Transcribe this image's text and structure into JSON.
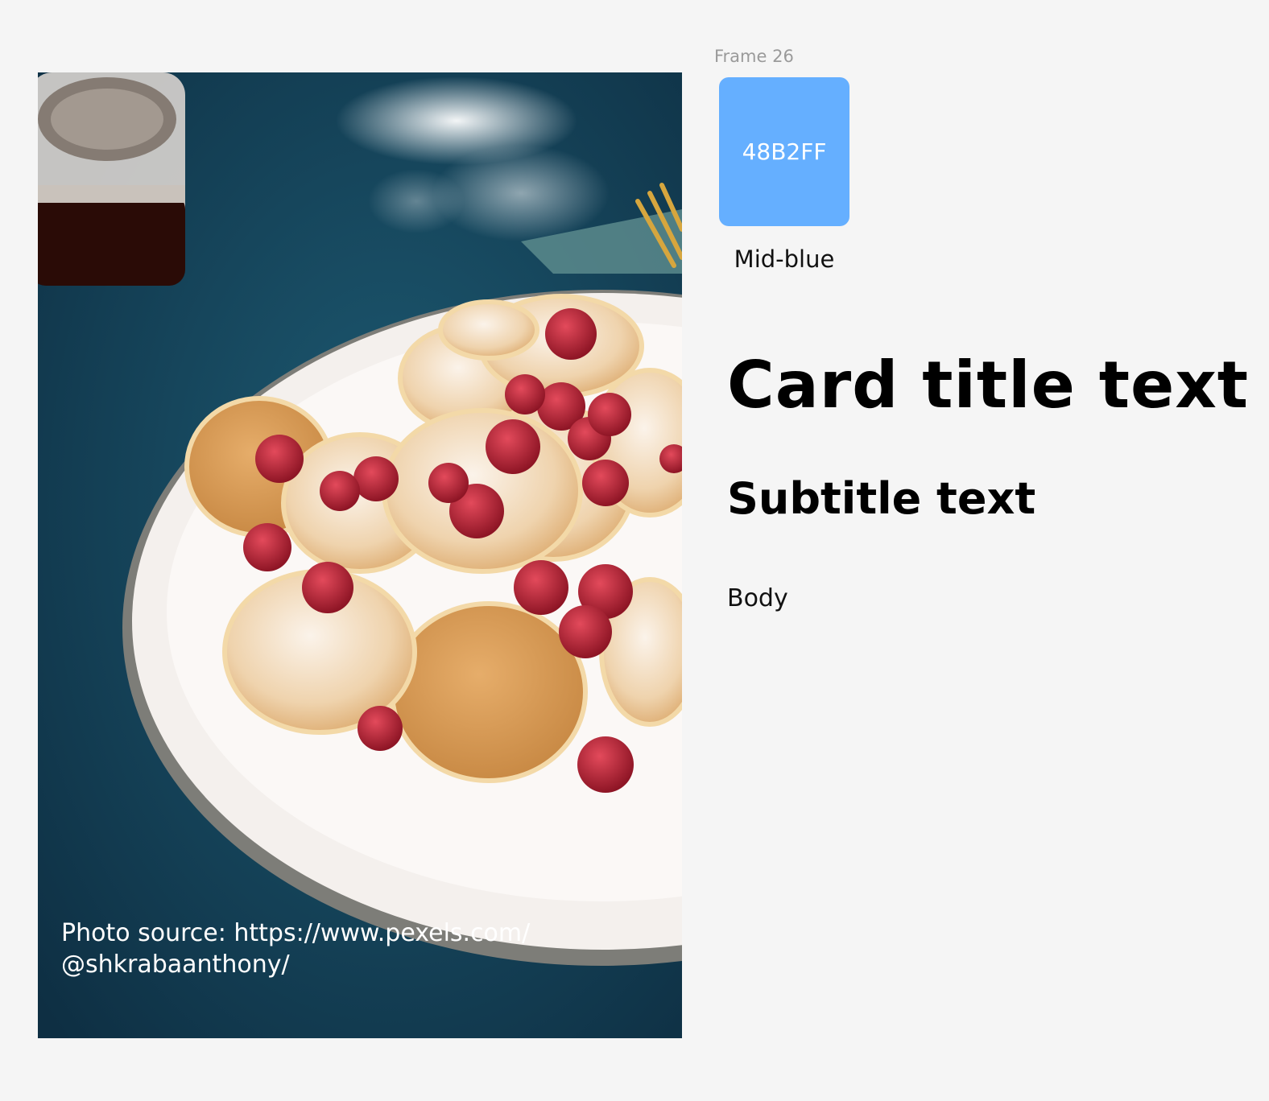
{
  "photo": {
    "alt_subject": "pancakes-with-raspberries",
    "credit": "Photo source: https://www.pexels.com/\n@shkrabaanthony/"
  },
  "frame": {
    "label": "Frame 26"
  },
  "swatch": {
    "hex_label": "48B2FF",
    "color": "#65afff",
    "name": "Mid-blue"
  },
  "typography": {
    "card_title": "Card title text",
    "subtitle": "Subtitle text",
    "body": "Body"
  },
  "colors": {
    "background": "#f5f5f5",
    "photo_background": "#134057",
    "text_primary": "#000000",
    "text_muted": "#9a9a9a"
  }
}
